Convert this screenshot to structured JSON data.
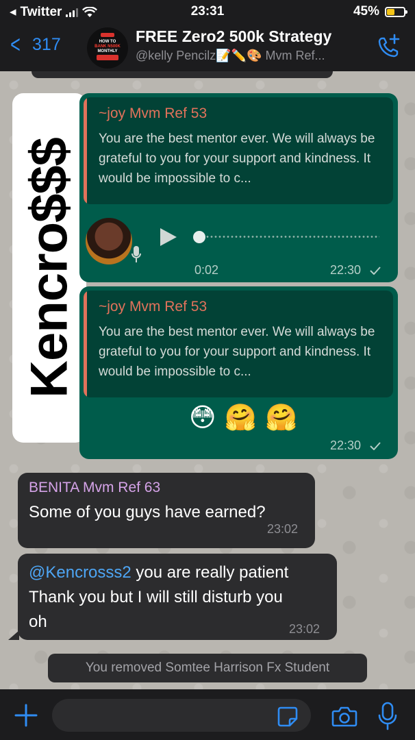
{
  "status_bar": {
    "back_app": "Twitter",
    "time": "23:31",
    "battery_percent": "45%",
    "battery_level": 0.45,
    "battery_color": "#f5c518"
  },
  "header": {
    "back_count": "317",
    "title": "FREE Zero2 500k Strategy",
    "subtitle": "@kelly Pencilz📝✏️🎨 Mvm Ref...",
    "group_avatar_lines": [
      "HOW TO",
      "BANK N500K",
      "MONTHLY"
    ],
    "call_icon": "phone-plus-icon",
    "accent_color": "#2f8cf3"
  },
  "messages": {
    "sticker": {
      "text": "Kencro$$$"
    },
    "voice_message": {
      "quote_author": "~joy Mvm Ref 53",
      "quote_text": "You are the best mentor ever. We will always be grateful to you for your support and kindness. It would be impossible to c...",
      "duration": "0:02",
      "time": "22:30"
    },
    "emoji_message": {
      "quote_author": "~joy Mvm Ref 53",
      "quote_text": "You are the best mentor ever. We will always be grateful to you for your support and kindness. It would be impossible to c...",
      "emojis": [
        "😳",
        "🤗",
        "🤗"
      ],
      "time": "22:30"
    },
    "incoming_1": {
      "sender": "BENITA Mvm Ref 63",
      "text": "Some of you guys have earned?",
      "time": "23:02"
    },
    "incoming_2": {
      "mention": "@Kencrosss2",
      "text_after_mention": " you are really patient",
      "line_2": "Thank you but I will still disturb you",
      "line_3": "oh",
      "time": "23:02"
    },
    "system_notice": "You removed Somtee Harrison Fx Student"
  },
  "input_bar": {
    "placeholder": "",
    "value": "",
    "icons": [
      "plus-icon",
      "sticker-icon",
      "camera-icon",
      "microphone-icon"
    ]
  },
  "colors": {
    "outgoing_bubble": "#005c4b",
    "incoming_bubble": "#2c2c2e",
    "quote_author": "#e2725b",
    "sender_name": "#d5a3e8",
    "mention": "#4ea6f5"
  }
}
